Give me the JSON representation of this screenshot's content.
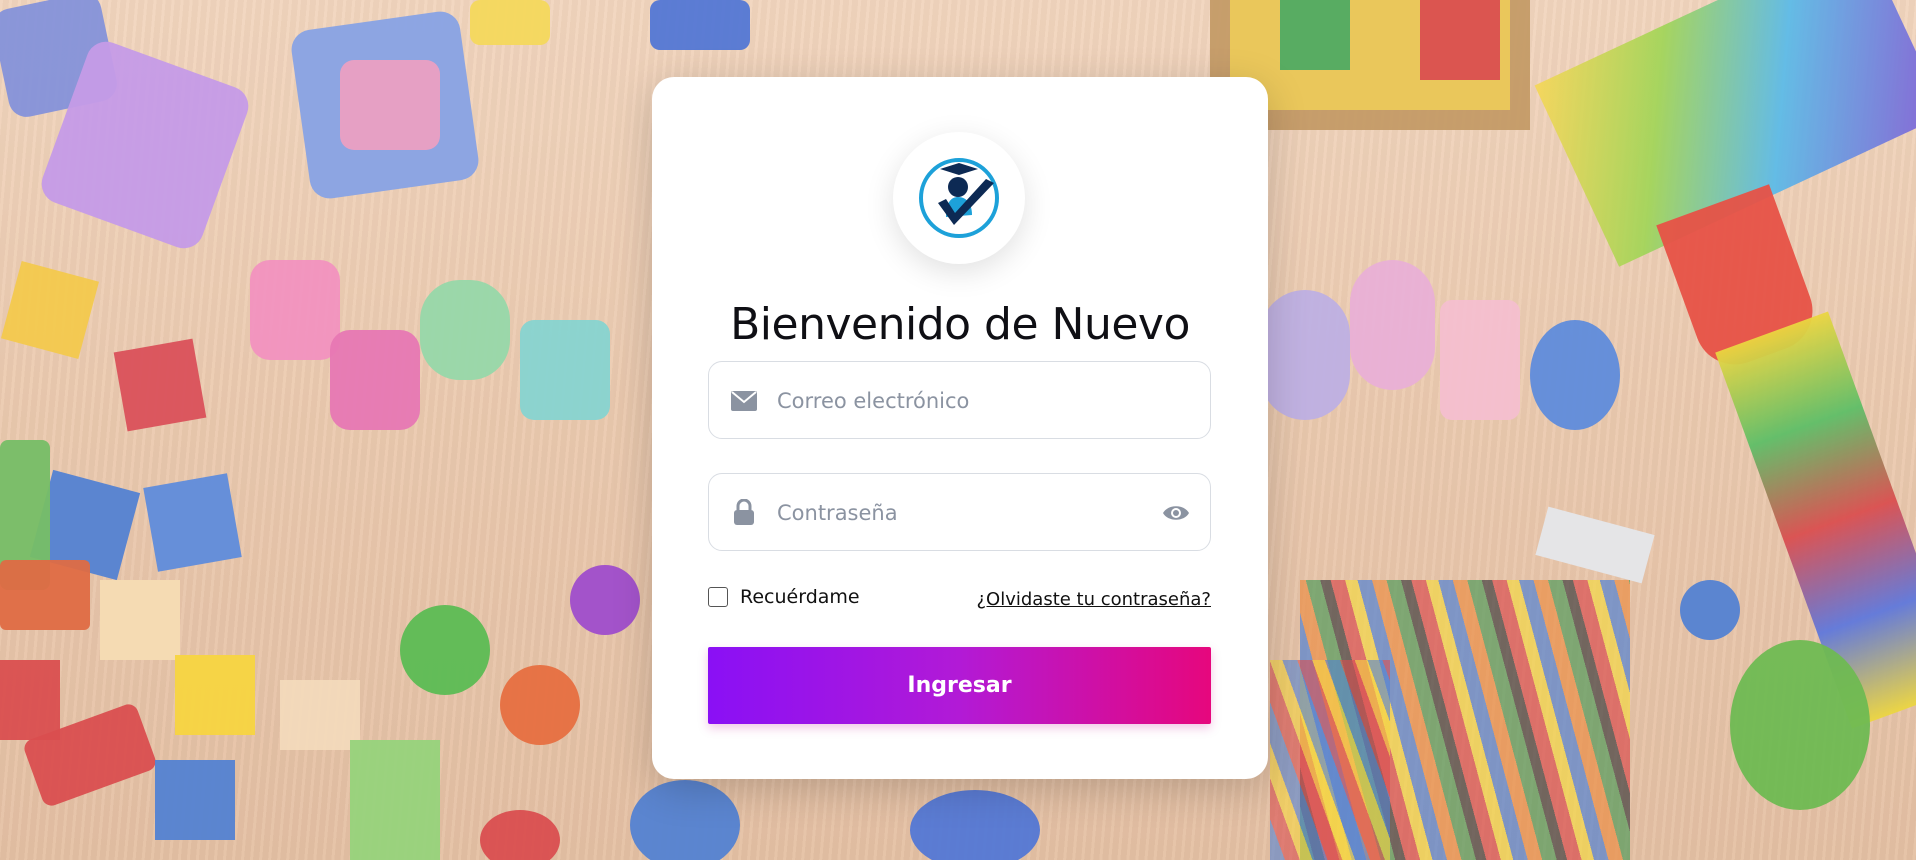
{
  "login": {
    "title": "Bienvenido de Nuevo",
    "email_placeholder": "Correo electrónico",
    "password_placeholder": "Contraseña",
    "remember_label": "Recuérdame",
    "forgot_link": "¿Olvidaste tu contraseña?",
    "submit_label": "Ingresar"
  },
  "icons": {
    "email": "envelope-icon",
    "password": "lock-icon",
    "show_password": "eye-icon",
    "logo": "graduate-check-logo"
  },
  "colors": {
    "button_gradient_start": "#8a10f5",
    "button_gradient_end": "#e6077d",
    "logo_blue": "#1da1d9",
    "logo_navy": "#0d2a54",
    "icon_gray": "#8b93a1"
  }
}
